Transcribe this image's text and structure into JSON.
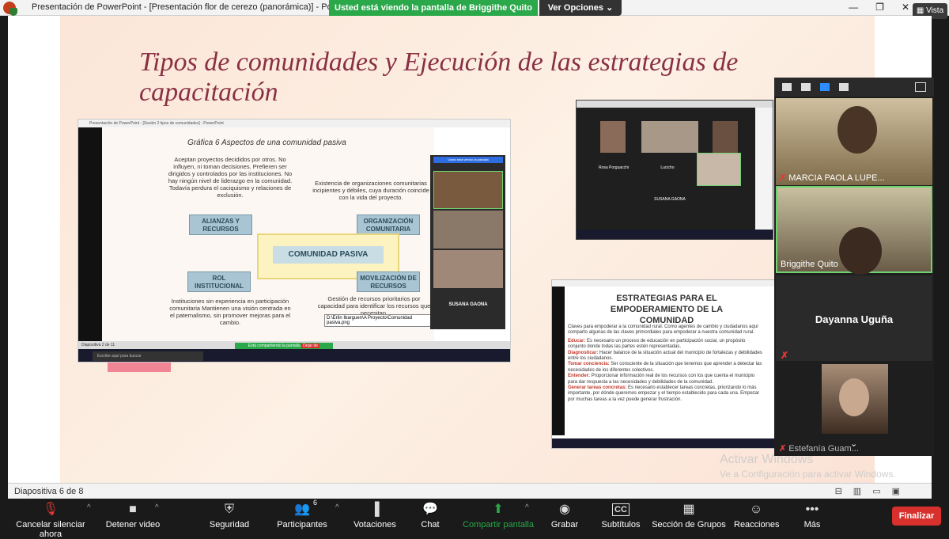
{
  "window": {
    "title": "Presentación de PowerPoint - [Presentación flor de cerezo (panorámica)] - PowerP",
    "share_banner": "Usted está viendo la pantalla de Briggithe Quito",
    "view_options": "Ver Opciones",
    "view_options_icon": "chevron-down-icon",
    "controls": {
      "minimize": "—",
      "restore": "❐",
      "close": "✕"
    },
    "vista_label": "Vista"
  },
  "slide": {
    "title": "Tipos de comunidades y Ejecución de las estrategias de capacitación",
    "shot1": {
      "window_title": "Presentación de PowerPoint - [Sesión 2 tipos de comunidades] - PowerPoint",
      "heading": "Gráfica 6 Aspectos de una comunidad pasiva",
      "text_top_left": "Aceptan proyectos decididos por otros. No influyen, ni toman decisiones. Prefieren ser dirigidos y controlados por las instituciones. No hay ningún nivel de liderazgo en la comunidad. Todavía perdura el caciquismo y relaciones de exclusión.",
      "text_top_right": "Existencia de organizaciones comunitarias incipientes y débiles, cuya duración coincide con la vida del proyecto.",
      "box_alianzas": "ALIANZAS Y RECURSOS",
      "box_organizacion": "ORGANIZACIÓN COMUNITARIA",
      "center": "COMUNIDAD PASIVA",
      "box_rol": "ROL INSTITUCIONAL",
      "box_movilizacion": "MOVILIZACIÓN DE RECURSOS",
      "text_bottom_left": "Instituciones sin experiencia en participación comunitaria Mantienen una visión centrada en el paternalismo, sin promover mejoras para el cambio.",
      "text_bottom_right": "Gestión de recursos prioritarios por capacidad para identificar los recursos que necesitan.",
      "tooltip": "D:\\Erlin Ibarguen\\A Proyecto\\Comunidad pasiva.png",
      "status": "Diapositiva 2 de 11",
      "share_banner": "Está compartiendo la pantalla",
      "stop_label": "Dejar de",
      "search": "Escribe aquí para buscar",
      "gallery_name": "SUSANA GAONA",
      "gallery_banner": "Usted está viendo la pantalla"
    },
    "shot2": {
      "names": [
        "Rosa Porguacchi",
        "Lucicho",
        "SUSANA GAONA"
      ]
    },
    "shot3": {
      "heading": "ESTRATEGIAS PARA EL EMPODERAMIENTO DE LA COMUNIDAD",
      "intro": "Claves para empoderar a la comunidad rural. Como agentes de cambio y ciudadanos aquí comparto algunas de las claves primordiales para empoderar a nuestra comunidad rural.",
      "items": [
        {
          "label": "Educar:",
          "text": "Es necesario un proceso de educación en participación social, un propósito conjunto donde todas las partes estén representadas."
        },
        {
          "label": "Diagnosticar:",
          "text": "Hacer balance de la situación actual del municipio de fortalezas y debilidades entre los ciudadanos."
        },
        {
          "label": "Tomar conciencia:",
          "text": "Ser consciente de la situación que tenemos que aprender a detectar las necesidades de los diferentes colectivos."
        },
        {
          "label": "Entender:",
          "text": "Proporcionar información real de los recursos con los que cuenta el municipio para dar respuesta a las necesidades y debilidades de la comunidad."
        },
        {
          "label": "Generar tareas concretas:",
          "text": "Es necesario establecer tareas concretas, priorizando lo más importante, por dónde queremos empezar y el tiempo establecido para cada una. Empezar por muchas tareas a la vez puede generar frustración."
        }
      ]
    }
  },
  "status_bar": {
    "slide_number": "Diapositiva 6 de 8",
    "icons": [
      "notes-icon",
      "grid-icon",
      "reading-icon",
      "slideshow-icon"
    ]
  },
  "activation": {
    "line1": "Activar Windows",
    "line2": "Ve a Configuración para activar Windows."
  },
  "gallery": {
    "participants": [
      {
        "name": "MARCIA PAOLA LUPE...",
        "muted": true
      },
      {
        "name": "Briggithe Quito",
        "muted": false
      },
      {
        "name": "Dayanna Uguña",
        "muted": true
      },
      {
        "name": "Estefanía Guam...",
        "muted": true
      }
    ]
  },
  "toolbar": {
    "unmute": "Cancelar silenciar ahora",
    "stop_video": "Detener video",
    "security": "Seguridad",
    "participants": "Participantes",
    "participants_count": "6",
    "polls": "Votaciones",
    "chat": "Chat",
    "share": "Compartir pantalla",
    "record": "Grabar",
    "subtitles": "Subtítulos",
    "subtitles_icon_text": "CC",
    "breakout": "Sección de Grupos",
    "reactions": "Reacciones",
    "more": "Más",
    "end": "Finalizar"
  },
  "colors": {
    "accent_green": "#2aa84a",
    "end_red": "#d8302d",
    "slide_title": "#8a3044"
  }
}
